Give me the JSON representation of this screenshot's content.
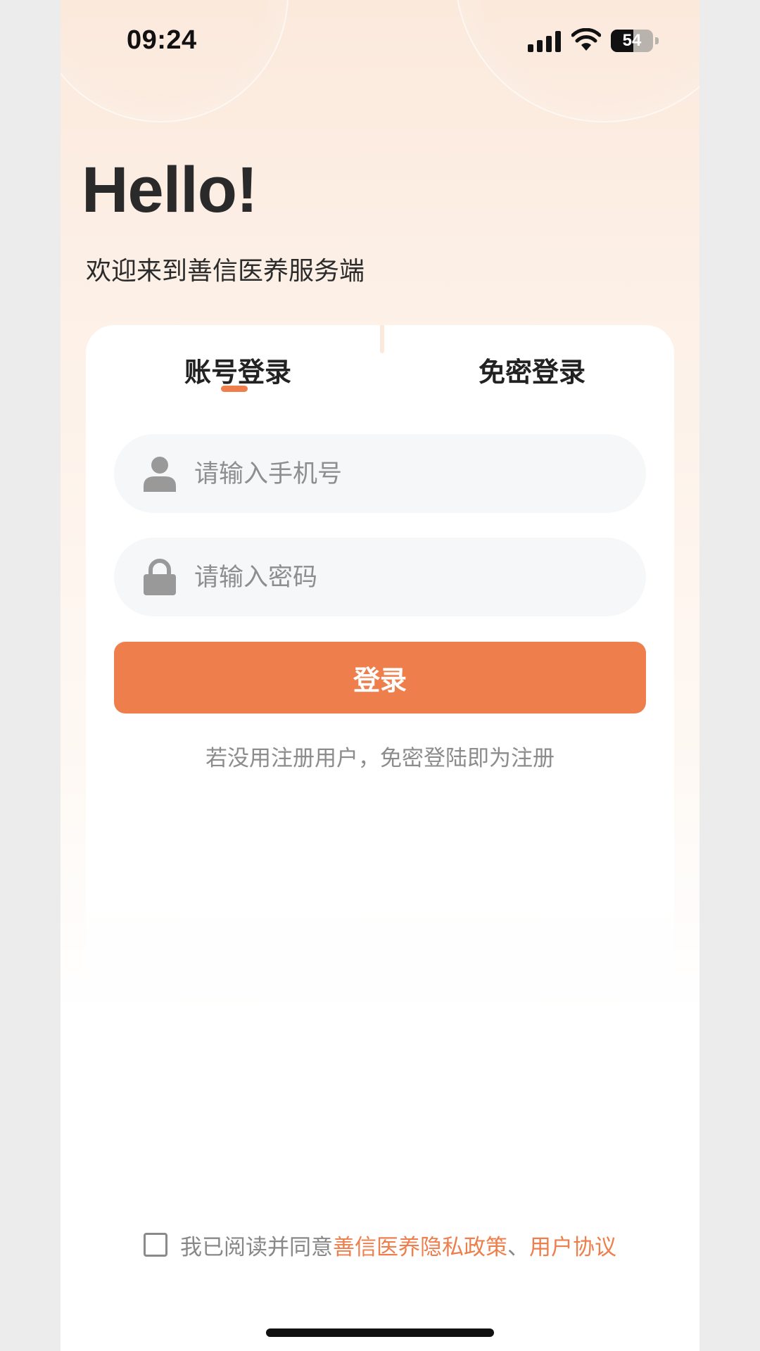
{
  "status_bar": {
    "time": "09:24",
    "battery": "54",
    "battery_level": 0.54
  },
  "header": {
    "title": "Hello!",
    "subtitle": "欢迎来到善信医养服务端"
  },
  "tabs": [
    {
      "label": "账号登录",
      "active": true
    },
    {
      "label": "免密登录",
      "active": false
    }
  ],
  "form": {
    "phone_placeholder": "请输入手机号",
    "password_placeholder": "请输入密码",
    "login_label": "登录",
    "hint": "若没用注册用户，免密登陆即为注册"
  },
  "agreement": {
    "prefix": "我已阅读并同意",
    "privacy_link": "善信医养隐私政策",
    "separator": "、",
    "terms_link": "用户协议",
    "checked": false
  },
  "colors": {
    "accent": "#ee7f4d",
    "field_bg": "#f6f7f9",
    "text_dark": "#222222",
    "text_muted": "#8e8e8e"
  },
  "icons": {
    "phone_field": "user-icon",
    "password_field": "lock-icon"
  }
}
